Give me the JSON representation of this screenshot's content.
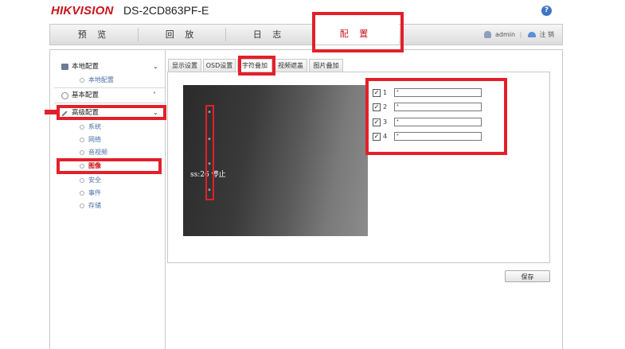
{
  "header": {
    "logo": "HIKVISION",
    "model": "DS-2CD863PF-E",
    "help_icon": "?"
  },
  "nav": {
    "tabs": [
      "预 览",
      "回 放",
      "日 志",
      "配 置"
    ],
    "active": "配 置",
    "user": "admin",
    "separator": "|",
    "logout": "注 销"
  },
  "sidebar": {
    "local": {
      "label": "本地配置",
      "chevron": "⌄",
      "items": [
        "本地配置"
      ]
    },
    "basic": {
      "label": "基本配置",
      "chevron": "˄"
    },
    "advanced": {
      "label": "高级配置",
      "chevron": "⌄",
      "items": [
        "系统",
        "网络",
        "音视频",
        "图像",
        "安全",
        "事件",
        "存储"
      ],
      "active_item": "图像"
    }
  },
  "subtabs": [
    "显示设置",
    "OSD设置",
    "字符叠加",
    "视频遮盖",
    "图片叠加"
  ],
  "active_subtab": "字符叠加",
  "preview": {
    "markers": [
      "*",
      "*",
      "*",
      "*"
    ],
    "overlay_text": "ss:26 停止"
  },
  "overlays": [
    {
      "num": "1",
      "checked": true,
      "value": "*"
    },
    {
      "num": "2",
      "checked": true,
      "value": "*"
    },
    {
      "num": "3",
      "checked": true,
      "value": "*"
    },
    {
      "num": "4",
      "checked": true,
      "value": "*"
    }
  ],
  "checkmark": "✓",
  "save_label": "保存",
  "colors": {
    "brand_red": "#c8161d",
    "annotation_red": "#e3202a",
    "link_blue": "#4a6fa5"
  }
}
